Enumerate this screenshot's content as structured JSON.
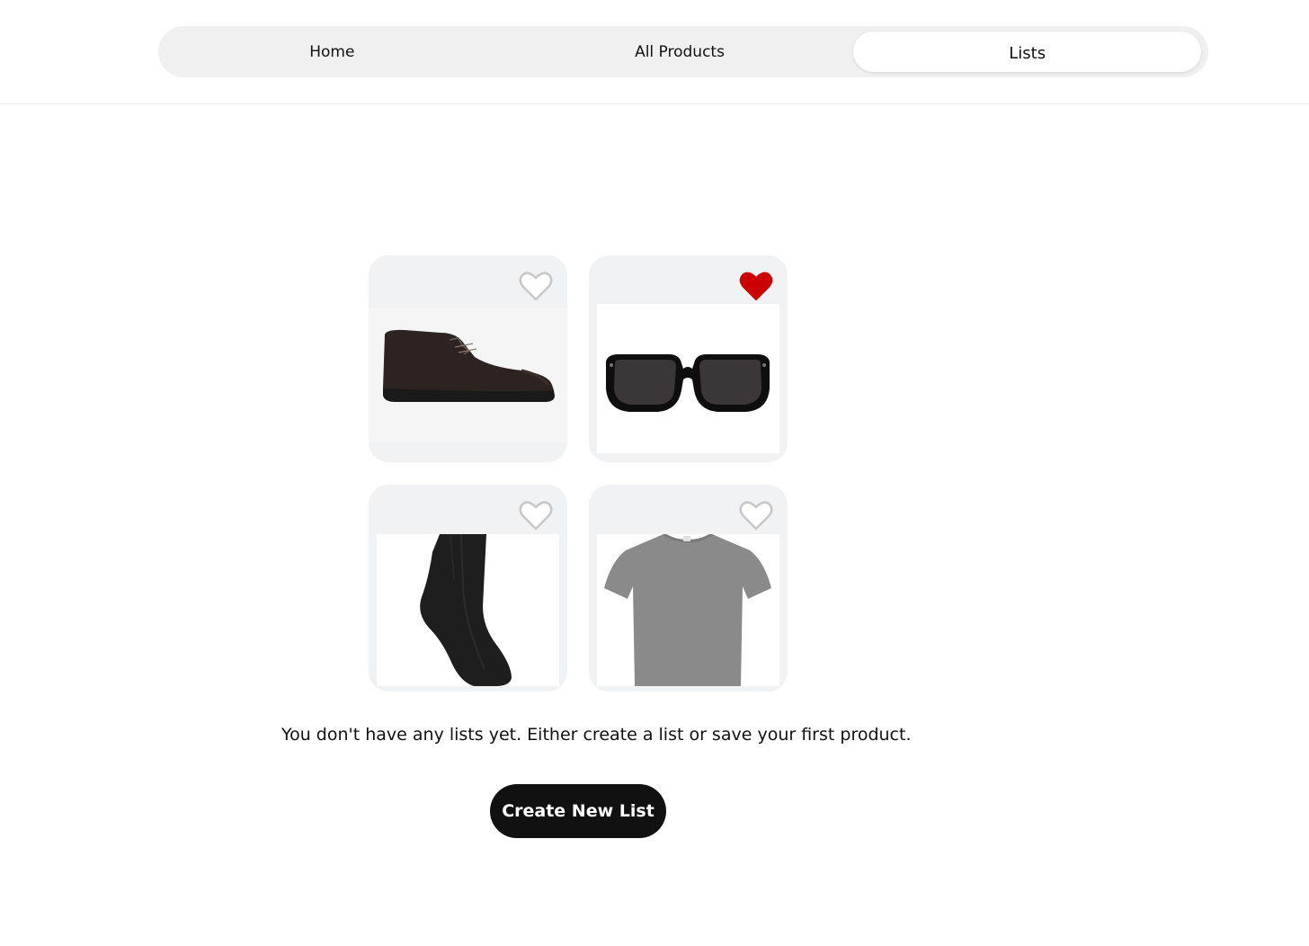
{
  "nav": {
    "tabs": [
      {
        "label": "Home"
      },
      {
        "label": "All Products"
      },
      {
        "label": "Lists"
      }
    ],
    "active_tab": "Lists"
  },
  "products": [
    {
      "icon": "chukka-boot-image",
      "saved": false
    },
    {
      "icon": "sunglasses-image",
      "saved": true
    },
    {
      "icon": "black-sock-image",
      "saved": false
    },
    {
      "icon": "grey-tshirt-image",
      "saved": false
    }
  ],
  "empty_state": {
    "message": "You don't have any lists yet. Either create a list or save your first product.",
    "button_label": "Create New List"
  },
  "colors": {
    "saved_heart": "#cc0000",
    "unsaved_heart_outline": "#c8c8c8",
    "button_bg": "#111111"
  }
}
